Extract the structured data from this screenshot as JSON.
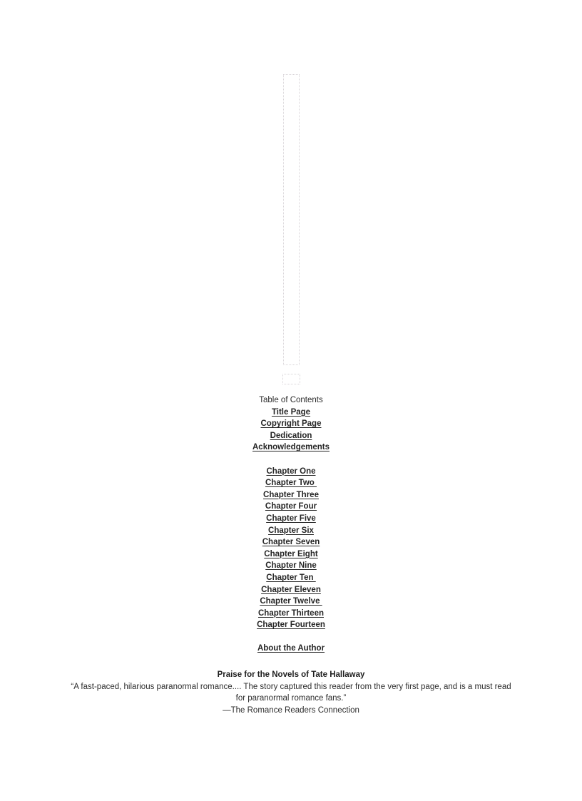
{
  "document": {
    "type": "ebook-front-matter",
    "background_color": "#ffffff",
    "text_color": "#2d2d2d",
    "link_color": "#262626"
  },
  "placeholders": [
    {
      "name": "cover-image-placeholder",
      "border_style": "dotted",
      "border_color": "#d8d4d8"
    },
    {
      "name": "logo-image-placeholder",
      "border_style": "dotted",
      "border_color": "#d8d4d8"
    }
  ],
  "toc": {
    "heading": "Table of Contents",
    "front_matter": [
      {
        "label": "Title Page"
      },
      {
        "label": "Copyright Page"
      },
      {
        "label": "Dedication"
      },
      {
        "label": "Acknowledgements"
      }
    ],
    "chapters": [
      {
        "label": "Chapter One"
      },
      {
        "label": "Chapter Two "
      },
      {
        "label": "Chapter Three"
      },
      {
        "label": "Chapter Four"
      },
      {
        "label": "Chapter Five"
      },
      {
        "label": "Chapter Six"
      },
      {
        "label": "Chapter Seven"
      },
      {
        "label": "Chapter Eight"
      },
      {
        "label": "Chapter Nine"
      },
      {
        "label": "Chapter Ten "
      },
      {
        "label": "Chapter Eleven"
      },
      {
        "label": "Chapter Twelve "
      },
      {
        "label": "Chapter Thirteen"
      },
      {
        "label": "Chapter Fourteen"
      }
    ],
    "back_matter": [
      {
        "label": "About the Author"
      }
    ]
  },
  "praise": {
    "heading": "Praise for the Novels of Tate Hallaway",
    "quote": "“A fast-paced, hilarious paranormal romance.... The story captured this reader from the very first page, and is a must read for paranormal romance fans.”",
    "attribution": "—The Romance Readers Connection"
  }
}
